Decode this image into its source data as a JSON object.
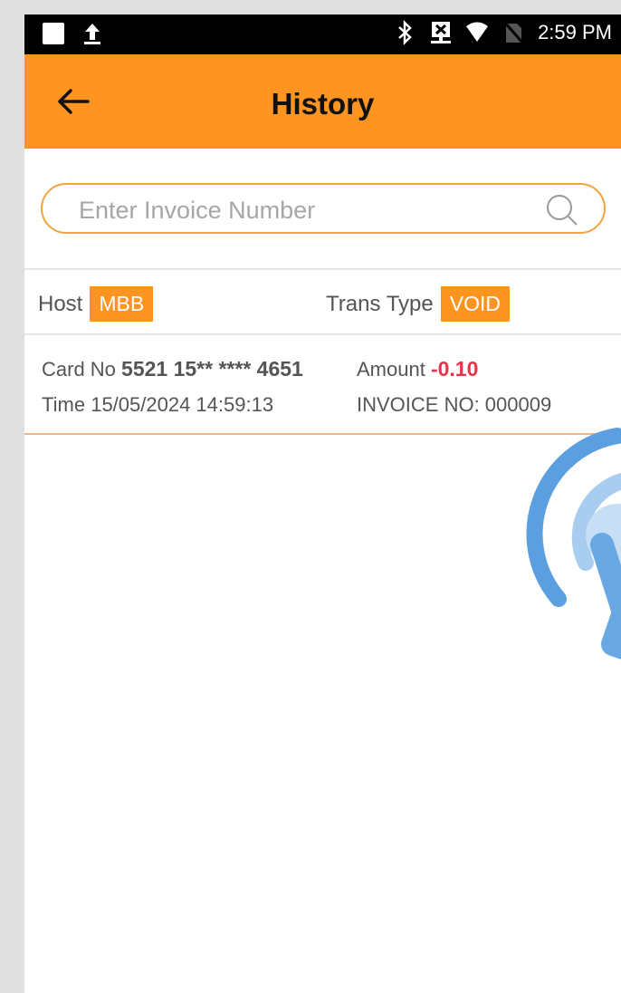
{
  "status_bar": {
    "time": "2:59 PM",
    "icons": [
      "square-icon",
      "upload-icon",
      "bluetooth-icon",
      "network-x-icon",
      "wifi-icon",
      "no-sim-icon"
    ]
  },
  "app_bar": {
    "title": "History",
    "back_icon": "arrow-left-icon"
  },
  "search": {
    "placeholder": "Enter Invoice Number",
    "value": ""
  },
  "filters": {
    "host_label": "Host",
    "host_value": "MBB",
    "trans_type_label": "Trans Type",
    "trans_type_value": "VOID"
  },
  "transactions": [
    {
      "card_label": "Card No",
      "card_no": "5521 15** **** 4651",
      "amount_label": "Amount",
      "amount": "-0.10",
      "time_label": "Time",
      "time": "15/05/2024 14:59:13",
      "invoice": "INVOICE NO: 000009"
    }
  ],
  "colors": {
    "accent": "#ff9420",
    "negative_amount": "#e8344b"
  }
}
